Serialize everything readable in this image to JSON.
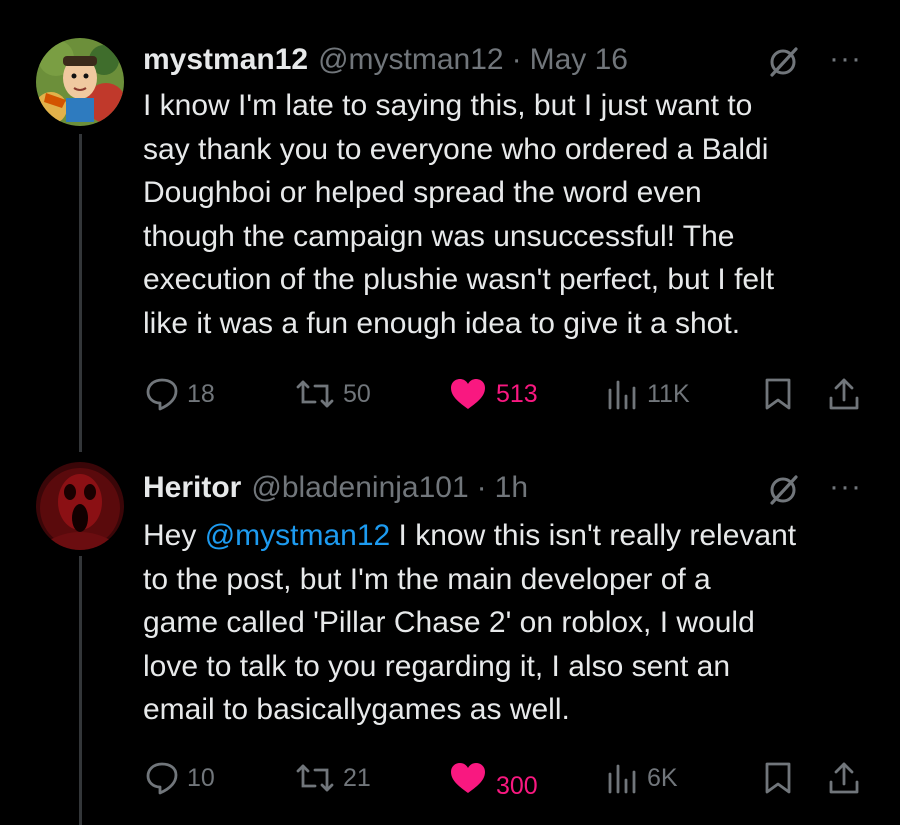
{
  "tweets": [
    {
      "name": "mystman12",
      "handle": "@mystman12",
      "separator": "·",
      "time": "May 16",
      "text_lines": [
        "I know I'm late to saying this, but I just want to",
        "say thank you to everyone who ordered a Baldi",
        "Doughboi or helped spread the word even",
        "though the campaign was unsuccessful! The",
        "execution of the plushie wasn't perfect, but I felt",
        "like it was a fun enough idea to give it a shot."
      ],
      "replies": "18",
      "reposts": "50",
      "likes": "513",
      "views": "11K",
      "more": "···"
    },
    {
      "name": "Heritor",
      "handle": "@bladeninja101",
      "separator": "·",
      "time": "1h",
      "text_first_prefix": "Hey ",
      "mention": "@mystman12",
      "text_first_suffix": " I know this isn't really relevant",
      "text_lines": [
        "to the post, but I'm the main developer of a",
        "game called 'Pillar Chase 2' on roblox, I would",
        "love to talk to you regarding it, I also sent an",
        "email to basicallygames as well."
      ],
      "replies": "10",
      "reposts": "21",
      "likes": "300",
      "views": "6K",
      "more": "···"
    }
  ],
  "colors": {
    "background": "#000000",
    "text": "#e7e9ea",
    "muted": "#71767b",
    "like": "#f91880",
    "mention": "#1d9bf0"
  },
  "icons": [
    "reply-icon",
    "repost-icon",
    "like-icon",
    "views-icon",
    "bookmark-icon",
    "share-icon",
    "grok-icon",
    "more-icon"
  ]
}
